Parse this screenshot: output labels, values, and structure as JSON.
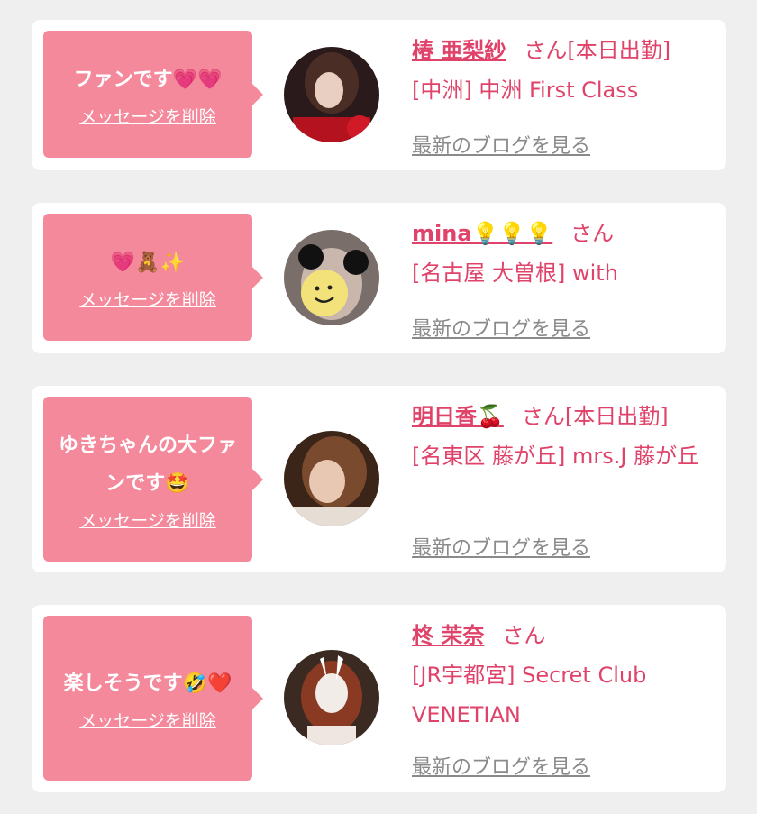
{
  "fans": [
    {
      "message": "ファンです💗💗",
      "delete_label": "メッセージを削除",
      "name": "椿 亜梨紗",
      "suffix": "さん[本日出勤]",
      "place": "[中洲] 中洲 First Class",
      "blog_label": "最新のブログを見る"
    },
    {
      "message": "💗🧸✨",
      "delete_label": "メッセージを削除",
      "name": "mina💡💡💡",
      "suffix": "さん",
      "place": "[名古屋 大曽根] with",
      "blog_label": "最新のブログを見る"
    },
    {
      "message": "ゆきちゃんの大ファンです🤩",
      "delete_label": "メッセージを削除",
      "name": "明日香🍒",
      "suffix": "さん[本日出勤]",
      "place": "[名東区 藤が丘] mrs.J 藤が丘",
      "blog_label": "最新のブログを見る"
    },
    {
      "message": "楽しそうです🤣❤️",
      "delete_label": "メッセージを削除",
      "name": "柊 茉奈",
      "suffix": "さん",
      "place": "[JR宇都宮] Secret Club VENETIAN",
      "blog_label": "最新のブログを見る"
    }
  ],
  "colors": {
    "accent": "#e0436a",
    "bubble": "#f5899c",
    "background": "#efefef",
    "link_gray": "#8a8a8a"
  }
}
